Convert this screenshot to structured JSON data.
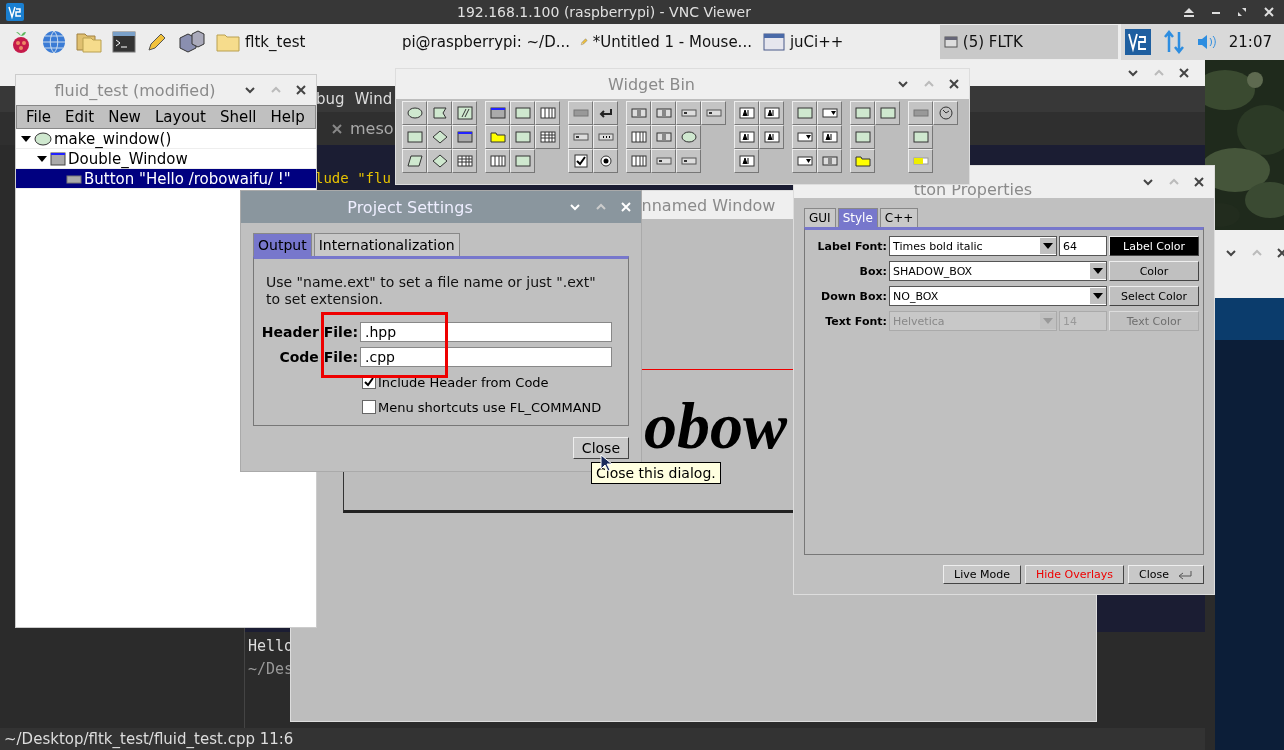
{
  "vnc_window": {
    "title": "192.168.1.100 (raspberrypi) - VNC Viewer"
  },
  "taskbar": {
    "tasks": [
      {
        "label": "fltk_test",
        "kind": "folder",
        "selected": false
      },
      {
        "label": "pi@raspberrypi: ~/D...",
        "kind": "terminal",
        "selected": false
      },
      {
        "label": "*Untitled 1 - Mouse...",
        "kind": "editor",
        "selected": false
      },
      {
        "label": "juCi++",
        "kind": "window",
        "selected": false
      },
      {
        "label": "(5) FLTK",
        "kind": "small-window",
        "selected": true
      }
    ],
    "clock": "21:07"
  },
  "editor_window": {
    "menu_fragments": [
      "bug",
      "Wind"
    ],
    "tab": "meso",
    "code_fragment": "lude \"flu",
    "terminal_lines": [
      "Hello",
      "~/Des"
    ],
    "status": "~/Desktop/fltk_test/fluid_test.cpp 11:6"
  },
  "fluid_window": {
    "title": "fluid_test (modified)",
    "menu": [
      "File",
      "Edit",
      "New",
      "Layout",
      "Shell",
      "Help"
    ],
    "tree": [
      {
        "label": "make_window()",
        "kind": "function",
        "expanded": true,
        "selected": false,
        "children": [
          {
            "label": "Double_Window",
            "kind": "window",
            "expanded": true,
            "selected": false,
            "children": [
              {
                "label": "Button  \"Hello /robowaifu/ !\"",
                "kind": "button",
                "selected": true
              }
            ]
          }
        ]
      }
    ]
  },
  "widget_bin": {
    "title": "Widget Bin"
  },
  "preview_window": {
    "title": "nnamed Window",
    "label_fragment": "obow"
  },
  "project_settings": {
    "title": "Project Settings",
    "tabs": [
      {
        "label": "Output",
        "selected": true
      },
      {
        "label": "Internationalization",
        "selected": false
      }
    ],
    "hint": "Use \"name.ext\" to set a file name or just \".ext\" to set extension.",
    "fields": [
      {
        "label": "Header File:",
        "value": ".hpp"
      },
      {
        "label": "Code File:",
        "value": ".cpp"
      }
    ],
    "options": [
      {
        "label": "Include Header from Code",
        "checked": true
      },
      {
        "label": "Menu shortcuts use FL_COMMAND",
        "checked": false
      }
    ],
    "close_button": "Close"
  },
  "tooltip": "Close this dialog.",
  "properties_window": {
    "title": "tton Properties",
    "tabs": [
      {
        "label": "GUI",
        "selected": false
      },
      {
        "label": "Style",
        "selected": true
      },
      {
        "label": "C++",
        "selected": false
      }
    ],
    "rows": [
      {
        "label": "Label Font:",
        "value": "Times bold italic",
        "size": "64",
        "button": "Label Color",
        "color": "#000000",
        "disabled": false
      },
      {
        "label": "Box:",
        "value": "SHADOW_BOX",
        "button": "Color",
        "color": "#c0c0c0",
        "disabled": false
      },
      {
        "label": "Down Box:",
        "value": "NO_BOX",
        "button": "Select Color",
        "color": "#c0c0c0",
        "disabled": false
      },
      {
        "label": "Text Font:",
        "value": "Helvetica",
        "size": "14",
        "button": "Text Color",
        "color": "#c0c0c0",
        "disabled": true
      }
    ],
    "buttons": [
      {
        "label": "Live Mode",
        "kind": "normal"
      },
      {
        "label": "Hide Overlays",
        "kind": "alert"
      },
      {
        "label": "Close",
        "kind": "return"
      }
    ]
  }
}
